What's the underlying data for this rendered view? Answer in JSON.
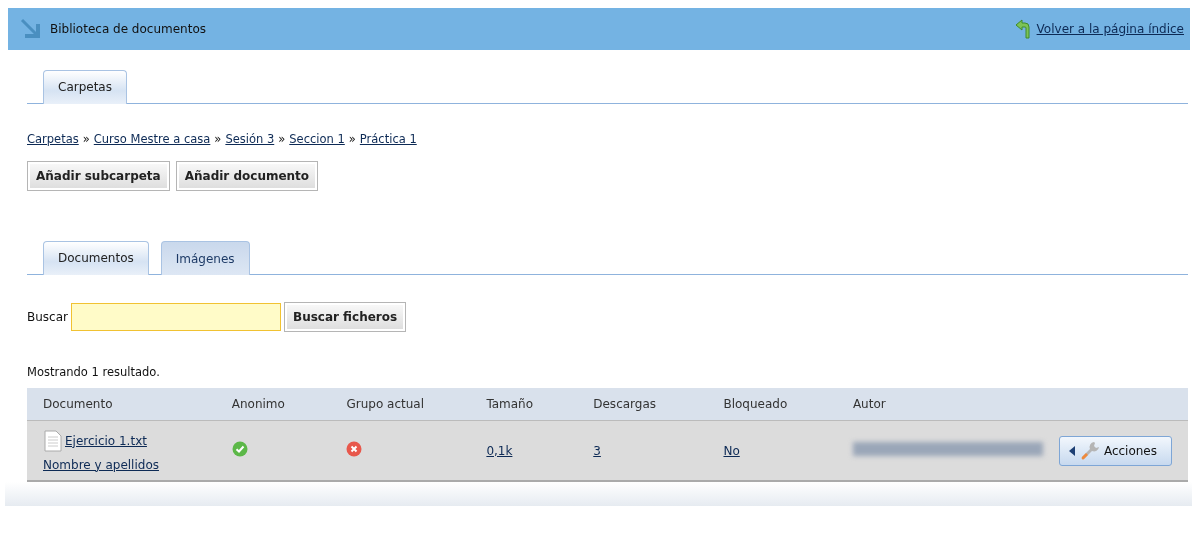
{
  "header": {
    "title": "Biblioteca de documentos",
    "back_link": "Volver a la página índice"
  },
  "folder_tabs": [
    {
      "label": "Carpetas",
      "selected": true
    }
  ],
  "breadcrumb": [
    "Carpetas",
    "Curso Mestre a casa",
    "Sesión 3",
    "Seccion 1",
    "Práctica 1"
  ],
  "breadcrumb_separator": "»",
  "buttons": [
    "Añadir subcarpeta",
    "Añadir documento"
  ],
  "view_tabs": [
    {
      "label": "Documentos",
      "selected": true
    },
    {
      "label": "Imágenes",
      "selected": false
    }
  ],
  "search": {
    "label": "Buscar",
    "button": "Buscar ficheros"
  },
  "result_count": "Mostrando 1 resultado.",
  "table": {
    "columns": [
      "Documento",
      "Anonimo",
      "Grupo actual",
      "Tamaño",
      "Descargas",
      "Bloqueado",
      "Autor"
    ],
    "rows": [
      {
        "document": "Ejercicio 1.txt",
        "name_link": "Nombre y apellidos",
        "anonymous": true,
        "current_group": false,
        "size": "0,1k",
        "downloads": "3",
        "locked": "No",
        "actions": "Acciones"
      }
    ]
  }
}
